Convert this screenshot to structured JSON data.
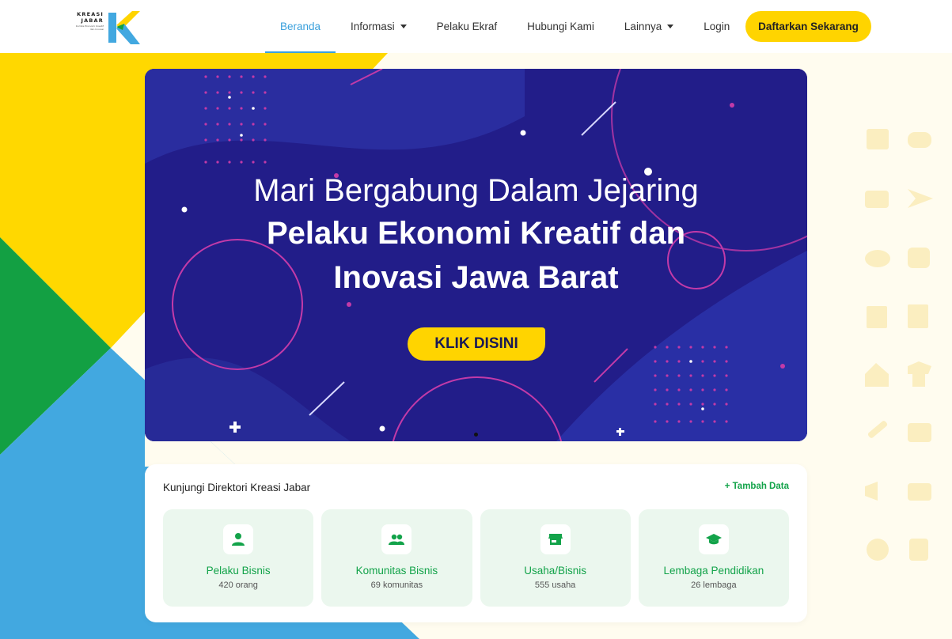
{
  "brand": {
    "line1": "KREASI",
    "line2": "JABAR",
    "sub": "Komite Ekonomi Kreatif dan Inovasi",
    "colors": {
      "yellow": "#ffd400",
      "green": "#13a34a",
      "blue": "#42a8e0",
      "navy": "#221d89"
    }
  },
  "nav": {
    "items": [
      {
        "label": "Beranda",
        "active": true
      },
      {
        "label": "Informasi",
        "dropdown": true
      },
      {
        "label": "Pelaku Ekraf"
      },
      {
        "label": "Hubungi Kami"
      },
      {
        "label": "Lainnya",
        "dropdown": true
      },
      {
        "label": "Login"
      }
    ],
    "cta": "Daftarkan Sekarang"
  },
  "hero": {
    "line1": "Mari Bergabung Dalam Jejaring",
    "line2": "Pelaku Ekonomi Kreatif dan",
    "line3": "Inovasi Jawa Barat",
    "button": "KLIK DISINI"
  },
  "directory": {
    "title": "Kunjungi Direktori Kreasi Jabar",
    "add_label": "+ Tambah Data",
    "tiles": [
      {
        "label": "Pelaku Bisnis",
        "count": "420 orang",
        "icon": "person-icon"
      },
      {
        "label": "Komunitas Bisnis",
        "count": "69 komunitas",
        "icon": "group-icon"
      },
      {
        "label": "Usaha/Bisnis",
        "count": "555 usaha",
        "icon": "store-icon"
      },
      {
        "label": "Lembaga Pendidikan",
        "count": "26 lembaga",
        "icon": "graduation-cap-icon"
      }
    ]
  }
}
